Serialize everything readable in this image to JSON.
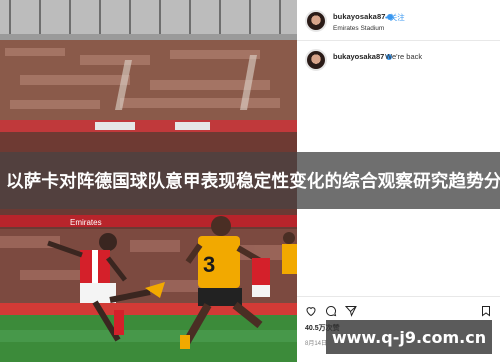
{
  "post": {
    "username": "bukayosaka87",
    "follow_label": "• 关注",
    "location": "Emirates Stadium",
    "caption_user": "bukayosaka87",
    "caption_text": "We're back",
    "likes": "40.5万次赞",
    "date": "8月14日"
  },
  "photo": {
    "ad_boards": [
      "Emirates",
      "Emirates",
      "Emirates"
    ],
    "player_number": "3"
  },
  "banner": {
    "title": "以萨卡对阵德国球队意甲表现稳定性变化的综合观察研究趋势分析"
  },
  "watermark": {
    "text": "www.q-j9.com.cn"
  },
  "colors": {
    "arsenal_red": "#d4202a",
    "wolves_gold": "#f2a900",
    "ig_blue": "#3897f0",
    "pitch": "#3c8b3a"
  }
}
